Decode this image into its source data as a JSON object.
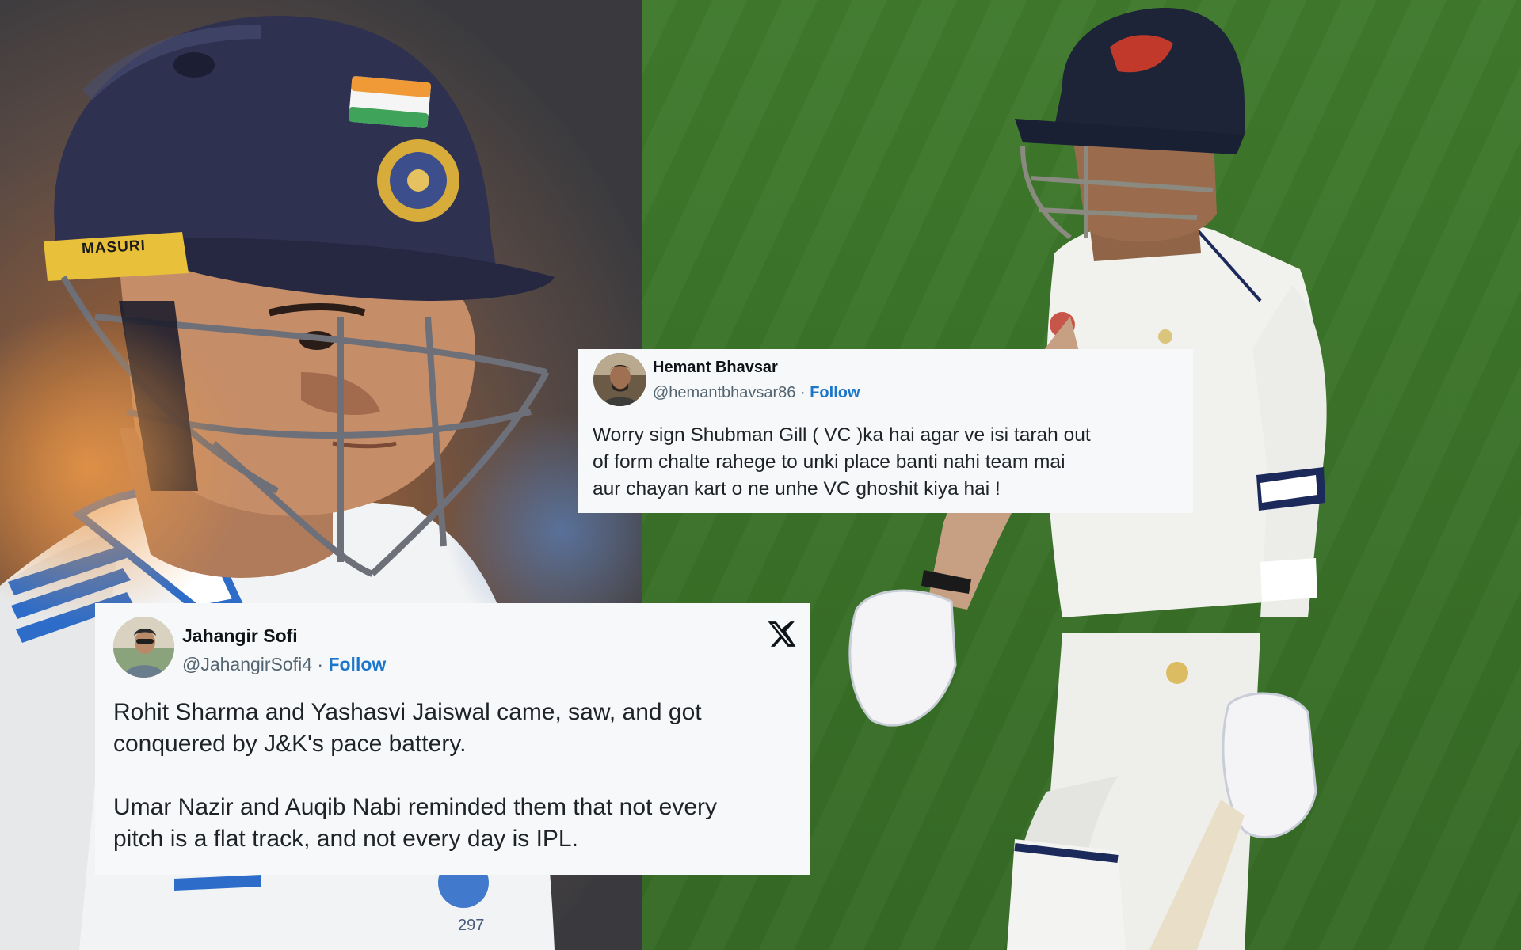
{
  "tweets": {
    "hemant": {
      "name": "Hemant Bhavsar",
      "handle": "@hemantbhavsar86",
      "separator": " · ",
      "follow_label": "Follow",
      "text": "Worry sign Shubman Gill ( VC )ka hai agar ve isi tarah out\nof form chalte rahege to unki place banti nahi team mai\naur chayan kart o ne unhe VC ghoshit kiya hai !"
    },
    "jahangir": {
      "name": "Jahangir Sofi",
      "handle": "@JahangirSofi4",
      "separator": " · ",
      "follow_label": "Follow",
      "text": "Rohit Sharma and Yashasvi Jaiswal came, saw, and got\nconquered by J&K's pace battery.\n\nUmar Nazir and Auqib Nabi reminded them that not every\npitch is a flat track, and not every day is IPL.",
      "logo_icon": "x-logo-icon"
    }
  },
  "photo_left": {
    "helmet_brand": "MASURI",
    "shirt_number": "297"
  },
  "colors": {
    "card_bg": "#f6f8f9",
    "follow": "#1d76c9",
    "handle": "#536471",
    "helmet": "#2e3150",
    "pitch_green": "#3b7329"
  }
}
